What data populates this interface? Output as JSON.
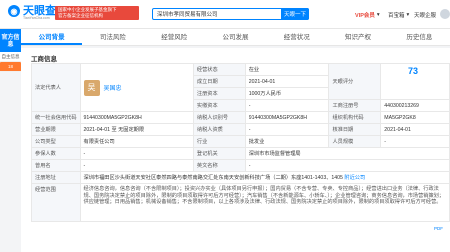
{
  "brand": {
    "name": "天眼查",
    "sub": "TianYanCha.com"
  },
  "slogan": {
    "line1": "国家中小企业发展子基金旗下",
    "line2": "官方备案企业征信机构"
  },
  "search": {
    "value": "深圳市孝同贸易有限公司",
    "button": "天眼一下"
  },
  "topnav": {
    "vip": "VIP会员",
    "service": "百宝箱",
    "app": "天眼企服"
  },
  "side": {
    "tab": "官方信息",
    "items": [
      "自主信息",
      "18"
    ]
  },
  "tabs": [
    {
      "label": "公司背景",
      "active": true
    },
    {
      "label": "司法风险"
    },
    {
      "label": "经营风险"
    },
    {
      "label": "公司发展"
    },
    {
      "label": "经营状况"
    },
    {
      "label": "知识产权"
    },
    {
      "label": "历史信息"
    }
  ],
  "info": {
    "title": "工商信息",
    "legal_rep_label": "法定代表人",
    "legal_rep_name": "吴国忠",
    "avatar_char": "吴",
    "status_label": "经营状态",
    "status_value": "在业",
    "reg_date_label": "成立日期",
    "reg_date_value": "2021-04-01",
    "reg_capital_label": "注册资本",
    "reg_capital_value": "1000万人民币",
    "paid_capital_label": "实缴资本",
    "paid_capital_value": "-",
    "rating_label": "天眼评分",
    "rating_value": "73",
    "reg_no_label": "工商注册号",
    "reg_no_value": "440300213269",
    "uscc_label": "统一社会信用代码",
    "uscc_value": "91440300MA5GP2GK8H",
    "taxpayer_label": "纳税人识别号",
    "taxpayer_value": "91440300MA5GP2GK8H",
    "org_code_label": "组织机构代码",
    "org_code_value": "MA5GP2GK8",
    "term_label": "营业期限",
    "term_value": "2021-04-01 至 无固定期限",
    "qual_label": "纳税人资质",
    "qual_value": "-",
    "approve_label": "核准日期",
    "approve_value": "2021-04-01",
    "type_label": "公司类型",
    "type_value": "有限责任公司",
    "industry_label": "行业",
    "industry_value": "批发业",
    "staff_label": "人员规模",
    "staff_value": "-",
    "insured_label": "参保人数",
    "insured_value": "-",
    "authority_label": "登记机关",
    "authority_value": "深圳市市场监督管理局",
    "former_label": "曾用名",
    "former_value": "-",
    "en_label": "英文名称",
    "en_value": "-",
    "address_label": "注册地址",
    "address_value": "深圳市福田区沙头街道天安社区泰然四路与泰然南路交汇处东南天安创新科技广场（二期）东座1401-1403、1405",
    "address_link": "附近公司",
    "scope_label": "经营范围",
    "scope_value": "经济信息咨询，信息咨询（不含限制项目）；投资兴办实业（具体项目另行申报）；国内贸易（不含专营、专卖、专控商品）；经营进出口业务（法律、行政法规、国务院决定禁止的项目除外，限制的项目须取得许可后方可经营）；汽车销售（不含新能源车、小轿车、）；企业管理咨询；商务信息咨询，市场营销策划；供应链管理；日用品销售；机械设备销售；不含限制项目，以上各项涉及法律、行政法规、国务院决定禁止的项目除外，限制的项目须取得许可后方可经营。",
    "pdf": "PDF"
  }
}
